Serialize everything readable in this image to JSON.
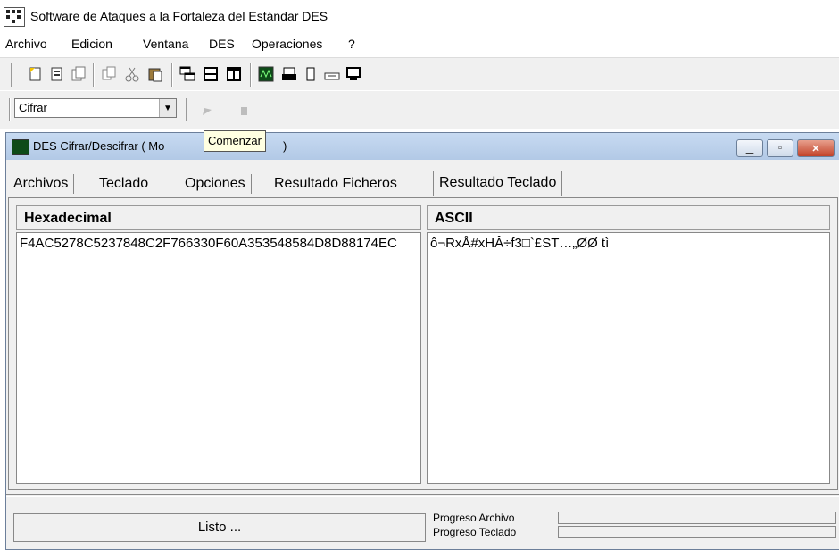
{
  "app": {
    "title": "Software de Ataques a la Fortaleza del Estándar DES"
  },
  "menu": [
    "Archivo",
    "Edicion",
    "Ventana",
    "DES",
    "Operaciones",
    "?"
  ],
  "toolbar": {
    "buttons": [
      "new-doc-icon",
      "open-doc-icon",
      "copy-doc-icon",
      "copy-icon",
      "cut-icon",
      "paste-icon",
      "cascade-icon",
      "tile-horizontal-icon",
      "tile-vertical-icon",
      "des-window-icon",
      "printer-icon",
      "tower-icon",
      "keyboard-icon",
      "monitor-icon"
    ],
    "mode_select": "Cifrar",
    "start_icon": "play-icon",
    "stop_icon": "stop-icon"
  },
  "tooltip": "Comenzar",
  "child_window": {
    "title": "DES Cifrar/Descifrar ( Mo",
    "title_tail": ")",
    "tabs": [
      "Archivos",
      "Teclado",
      "Opciones",
      "Resultado Ficheros",
      "Resultado Teclado"
    ],
    "active_tab": "Resultado Teclado",
    "hex_header": "Hexadecimal",
    "ascii_header": "ASCII",
    "hex_value": "F4AC5278C5237848C2F766330F60A353548584D8D88174EC",
    "ascii_value": "ô¬RxÅ#xHÂ÷f3□`£ST…„ØØ   tì"
  },
  "status": {
    "text": "Listo ...",
    "progress_file_label": "Progreso Archivo",
    "progress_keyboard_label": "Progreso Teclado",
    "progress_file": 0,
    "progress_keyboard": 0
  }
}
